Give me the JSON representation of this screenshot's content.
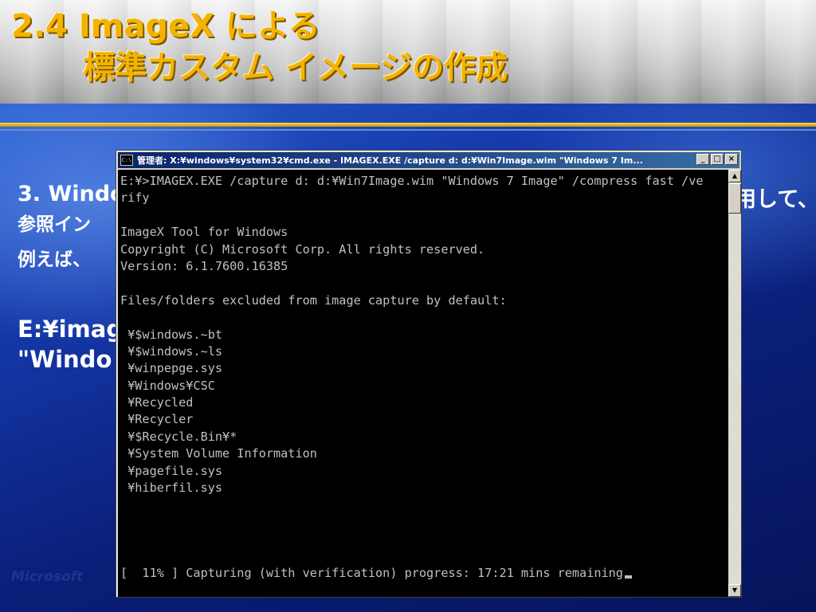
{
  "slide": {
    "title_line1": "2.4 ImageX による",
    "title_line2": "標準カスタム イメージの作成",
    "step_text": "3. Windo",
    "step_tail": "用して、",
    "ref_text": "参照イン",
    "example_text": "例えば、",
    "command_line1": "E:¥imag",
    "command_line2": "\"Windo",
    "footer_text": "Microsoft"
  },
  "cmd": {
    "window_title": "管理者: X:¥windows¥system32¥cmd.exe - IMAGEX.EXE  /capture d: d:¥Win7Image.wim \"Windows 7 Im...",
    "icon_label": "C:\\",
    "minimize_label": "_",
    "maximize_label": "□",
    "close_label": "×",
    "scroll_up_label": "▲",
    "scroll_down_label": "▼",
    "lines": [
      "E:¥>IMAGEX.EXE /capture d: d:¥Win7Image.wim \"Windows 7 Image\" /compress fast /ve",
      "rify",
      "",
      "ImageX Tool for Windows",
      "Copyright (C) Microsoft Corp. All rights reserved.",
      "Version: 6.1.7600.16385",
      "",
      "Files/folders excluded from image capture by default:",
      "",
      " ¥$windows.~bt",
      " ¥$windows.~ls",
      " ¥winpepge.sys",
      " ¥Windows¥CSC",
      " ¥Recycled",
      " ¥Recycler",
      " ¥$Recycle.Bin¥*",
      " ¥System Volume Information",
      " ¥pagefile.sys",
      " ¥hiberfil.sys",
      "",
      "",
      "",
      "",
      "[  11% ] Capturing (with verification) progress: 17:21 mins remaining"
    ]
  },
  "colors": {
    "title_gold": "#f3b300",
    "console_bg": "#000000",
    "console_text": "#c0c0c0",
    "titlebar_start": "#0a246a",
    "titlebar_end": "#3a6ea5"
  }
}
